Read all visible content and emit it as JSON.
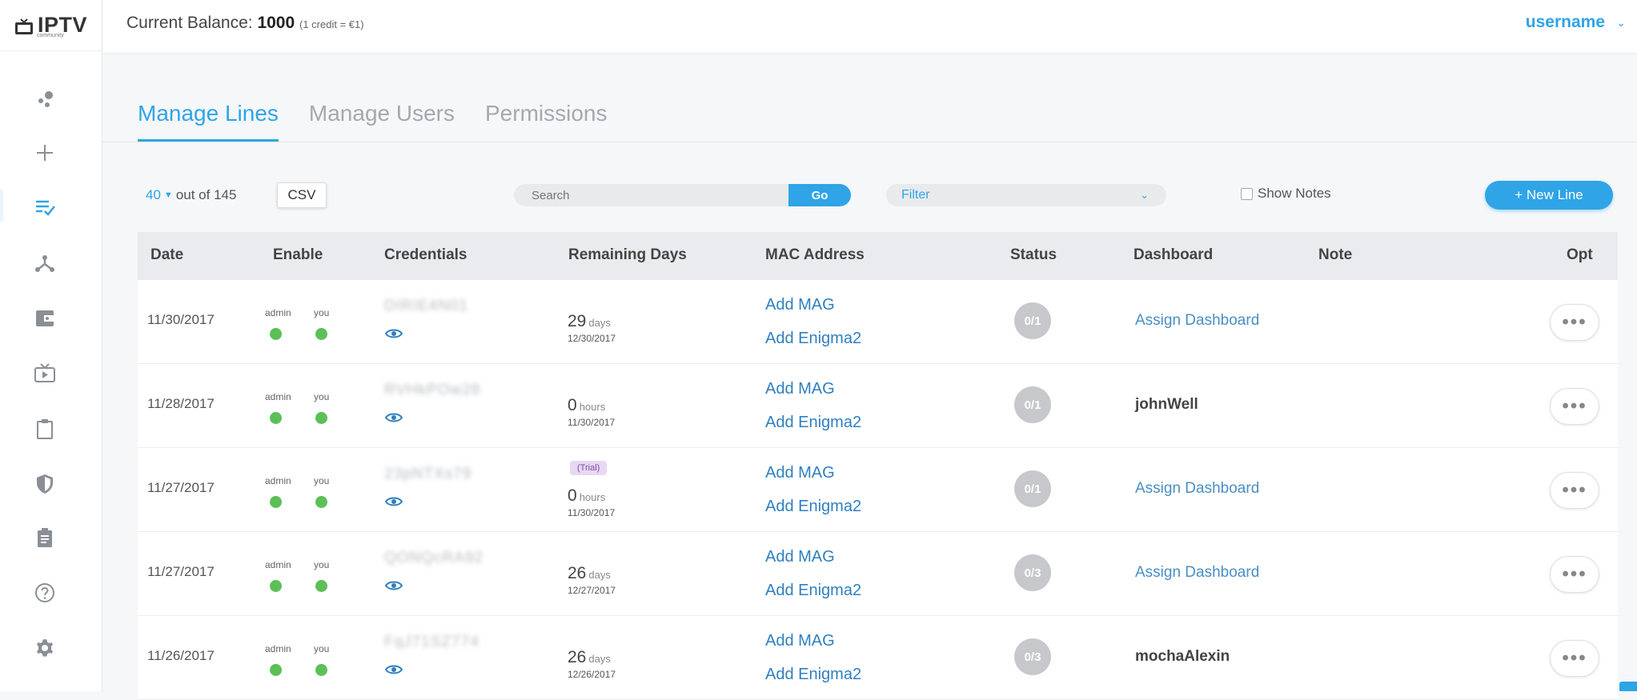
{
  "app": {
    "logo_text": "IPTV",
    "logo_sub": "community"
  },
  "topbar": {
    "balance_label": "Current Balance:",
    "balance_value": "1000",
    "balance_note": "(1 credit = €1)",
    "username": "username"
  },
  "sidebar": {
    "icons": [
      "dashboard-dots-icon",
      "plus-icon",
      "list-check-icon",
      "network-icon",
      "wallet-icon",
      "tv-icon",
      "clipboard-icon",
      "shield-icon",
      "clipboard-list-icon",
      "help-icon",
      "gear-icon"
    ],
    "active_icon": "list-check-icon"
  },
  "tabs": [
    {
      "label": "Manage Lines",
      "active": true
    },
    {
      "label": "Manage Users",
      "active": false
    },
    {
      "label": "Permissions",
      "active": false
    }
  ],
  "toolbar": {
    "page_size": "40",
    "out_of": "out of 145",
    "csv_label": "CSV",
    "search_placeholder": "Search",
    "go_label": "Go",
    "filter_label": "Filter",
    "show_notes_label": "Show Notes",
    "new_line_label": "+ New Line"
  },
  "table": {
    "headers": [
      "Date",
      "Enable",
      "Credentials",
      "Remaining Days",
      "MAC Address",
      "Status",
      "Dashboard",
      "Note",
      "Opt"
    ],
    "enable_labels": [
      "admin",
      "you"
    ],
    "mac_labels": [
      "Add MAG",
      "Add Enigma2"
    ],
    "opt_label": "•••",
    "rows": [
      {
        "date": "11/30/2017",
        "credentials": "DIRIE4N01",
        "remaining": "29",
        "unit": "days",
        "expires": "12/30/2017",
        "trial": null,
        "status": "0/1",
        "dashboard": "Assign Dashboard",
        "dashboard_is_link": true
      },
      {
        "date": "11/28/2017",
        "credentials": "RVHkPOw28",
        "remaining": "0",
        "unit": "hours",
        "expires": "11/30/2017",
        "trial": null,
        "status": "0/1",
        "dashboard": "johnWell",
        "dashboard_is_link": false
      },
      {
        "date": "11/27/2017",
        "credentials": "23pNTXs79",
        "remaining": "0",
        "unit": "hours",
        "expires": "11/30/2017",
        "trial": "(Trial)",
        "status": "0/1",
        "dashboard": "Assign Dashboard",
        "dashboard_is_link": true
      },
      {
        "date": "11/27/2017",
        "credentials": "QONQcRA92",
        "remaining": "26",
        "unit": "days",
        "expires": "12/27/2017",
        "trial": null,
        "status": "0/3",
        "dashboard": "Assign Dashboard",
        "dashboard_is_link": true
      },
      {
        "date": "11/26/2017",
        "credentials": "FqJ71SZ774",
        "remaining": "26",
        "unit": "days",
        "expires": "12/26/2017",
        "trial": null,
        "status": "0/3",
        "dashboard": "mochaAlexin",
        "dashboard_is_link": false
      }
    ]
  },
  "colors": {
    "accent": "#2fa4e7",
    "enabled_dot": "#5cc059",
    "status_badge": "#c6c8cb"
  }
}
